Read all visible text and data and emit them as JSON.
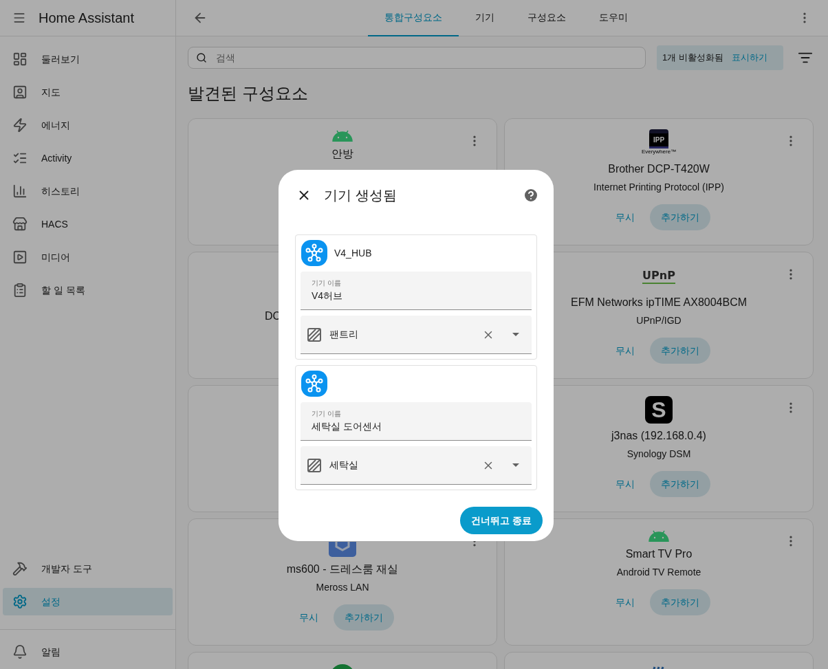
{
  "sidebar": {
    "title": "Home Assistant",
    "items": [
      {
        "label": "둘러보기",
        "selected": false
      },
      {
        "label": "지도",
        "selected": false
      },
      {
        "label": "에너지",
        "selected": false
      },
      {
        "label": "Activity",
        "selected": false
      },
      {
        "label": "히스토리",
        "selected": false
      },
      {
        "label": "HACS",
        "selected": false
      },
      {
        "label": "미디어",
        "selected": false
      },
      {
        "label": "할 일 목록",
        "selected": false
      }
    ],
    "bottom_items": [
      {
        "label": "개발자 도구",
        "selected": false
      },
      {
        "label": "설정",
        "selected": true
      }
    ],
    "notifications": "알림"
  },
  "tabs": [
    {
      "label": "통합구성요소",
      "selected": true
    },
    {
      "label": "기기",
      "selected": false
    },
    {
      "label": "구성요소",
      "selected": false
    },
    {
      "label": "도우미",
      "selected": false
    }
  ],
  "search": {
    "placeholder": "검색"
  },
  "disabled_chip": {
    "text": "1개 비활성화됨",
    "action": "표시하기"
  },
  "heading": "발견된 구성요소",
  "cards": [
    {
      "kind": "android",
      "name": "안방",
      "menu": true,
      "cut": false
    },
    {
      "kind": "ipp",
      "logo_text": "IPP",
      "logo_subtext": "Everywhere™",
      "name": "Brother DCP-T420W",
      "integration": "Internet Printing Protocol (IPP)",
      "ignore": "무시",
      "add": "추가하기",
      "menu": true,
      "cut": false
    },
    {
      "kind": "none",
      "name": "DC",
      "menu": false,
      "cut": true
    },
    {
      "kind": "upnp",
      "logo_text": "UPnP",
      "name": "EFM Networks ipTIME AX8004BCM",
      "integration": "UPnP/IGD",
      "ignore": "무시",
      "add": "추가하기",
      "menu": true,
      "cut": false
    },
    {
      "kind": "none"
    },
    {
      "kind": "synology",
      "logo_text": "S",
      "name": "j3nas (192.168.0.4)",
      "integration": "Synology DSM",
      "ignore": "무시",
      "add": "추가하기",
      "menu": true,
      "cut": false
    },
    {
      "kind": "meross",
      "name": "ms600 - 드레스룸 재실",
      "integration": "Meross LAN",
      "ignore": "무시",
      "add": "추가하기",
      "menu": true,
      "cut": false
    },
    {
      "kind": "android",
      "name": "Smart TV Pro",
      "integration": "Android TV Remote",
      "ignore": "무시",
      "add": "추가하기",
      "menu": true,
      "cut": false
    },
    {
      "kind": "round"
    },
    {
      "kind": "wave"
    }
  ],
  "dialog": {
    "title": "기기 생성됨",
    "devices": [
      {
        "name": "V4_HUB",
        "field_label": "기기 이름",
        "field_value": "V4허브",
        "area": "팬트리"
      },
      {
        "field_label": "기기 이름",
        "field_value": "세탁실 도어센서",
        "area": "세탁실"
      }
    ],
    "button": "건너뛰고 종료"
  }
}
